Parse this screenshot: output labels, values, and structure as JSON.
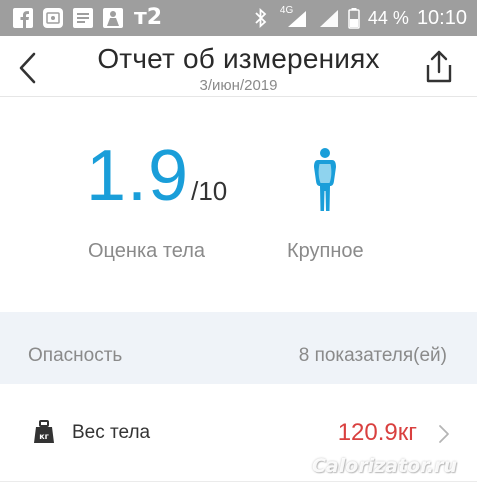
{
  "status_bar": {
    "network_label": "4G",
    "carrier_mark": "т2",
    "battery_percent": "44 %",
    "time": "10:10",
    "icons": [
      "facebook-icon",
      "image-notification-icon",
      "message-icon",
      "app-notification-icon",
      "bluetooth-icon",
      "signal-icon",
      "signal-icon",
      "battery-icon"
    ]
  },
  "header": {
    "title": "Отчет об измерениях",
    "date": "3/июн/2019",
    "back_icon": "chevron-left-icon",
    "share_icon": "share-icon"
  },
  "summary": {
    "score_value": "1.9",
    "score_max": "/10",
    "score_label": "Оценка тела",
    "body_type_label": "Крупное",
    "body_type_icon": "body-figure-icon",
    "accent_color": "#1a9ed9"
  },
  "risk": {
    "label": "Опасность",
    "count_text": "8 показателя(ей)"
  },
  "metrics": [
    {
      "icon": "weight-kg-icon",
      "icon_text": "кг",
      "label": "Вес тела",
      "value": "120.9кг",
      "value_color": "#d9403f"
    }
  ],
  "watermark": "Calorizator.ru"
}
